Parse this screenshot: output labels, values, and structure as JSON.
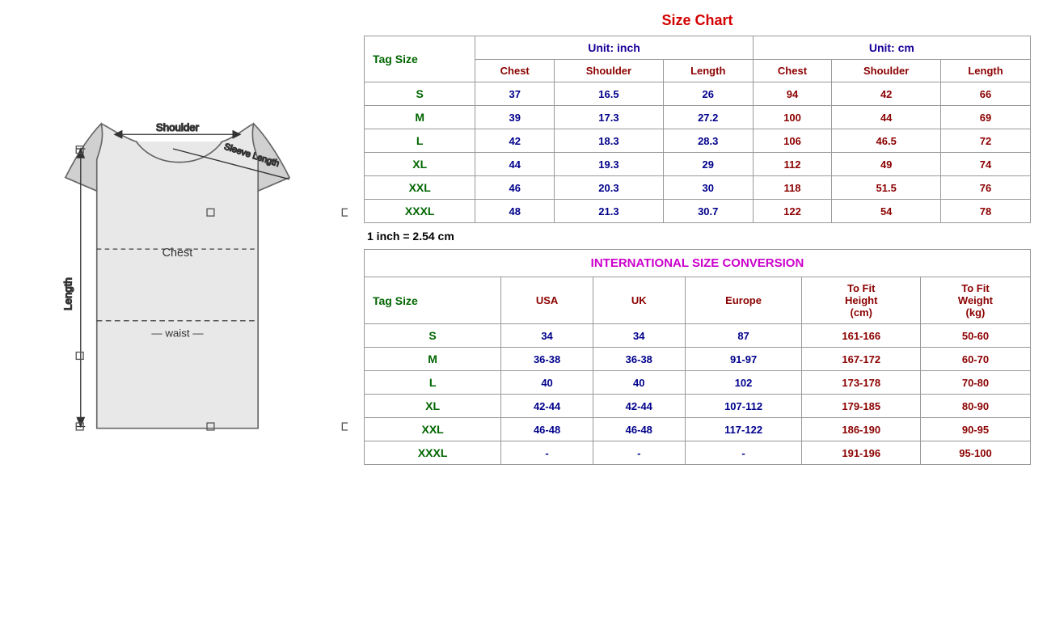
{
  "sizeChart": {
    "title": "Size Chart",
    "conversionNote": "1 inch = 2.54 cm",
    "unitInch": "Unit: inch",
    "unitCm": "Unit: cm",
    "tagSizeLabel": "Tag Size",
    "headers": {
      "chest": "Chest",
      "shoulder": "Shoulder",
      "length": "Length"
    },
    "rows": [
      {
        "tag": "S",
        "inch_chest": "37",
        "inch_shoulder": "16.5",
        "inch_length": "26",
        "cm_chest": "94",
        "cm_shoulder": "42",
        "cm_length": "66"
      },
      {
        "tag": "M",
        "inch_chest": "39",
        "inch_shoulder": "17.3",
        "inch_length": "27.2",
        "cm_chest": "100",
        "cm_shoulder": "44",
        "cm_length": "69"
      },
      {
        "tag": "L",
        "inch_chest": "42",
        "inch_shoulder": "18.3",
        "inch_length": "28.3",
        "cm_chest": "106",
        "cm_shoulder": "46.5",
        "cm_length": "72"
      },
      {
        "tag": "XL",
        "inch_chest": "44",
        "inch_shoulder": "19.3",
        "inch_length": "29",
        "cm_chest": "112",
        "cm_shoulder": "49",
        "cm_length": "74"
      },
      {
        "tag": "XXL",
        "inch_chest": "46",
        "inch_shoulder": "20.3",
        "inch_length": "30",
        "cm_chest": "118",
        "cm_shoulder": "51.5",
        "cm_length": "76"
      },
      {
        "tag": "XXXL",
        "inch_chest": "48",
        "inch_shoulder": "21.3",
        "inch_length": "30.7",
        "cm_chest": "122",
        "cm_shoulder": "54",
        "cm_length": "78"
      }
    ]
  },
  "intlConversion": {
    "title": "INTERNATIONAL SIZE CONVERSION",
    "tagSizeLabel": "Tag Size",
    "headers": {
      "usa": "USA",
      "uk": "UK",
      "europe": "Europe",
      "toFitHeight": "To Fit Height (cm)",
      "toFitWeight": "To Fit Weight (kg)",
      "toFitLabel": "To Fit"
    },
    "rows": [
      {
        "tag": "S",
        "usa": "34",
        "uk": "34",
        "europe": "87",
        "height": "161-166",
        "weight": "50-60"
      },
      {
        "tag": "M",
        "usa": "36-38",
        "uk": "36-38",
        "europe": "91-97",
        "height": "167-172",
        "weight": "60-70"
      },
      {
        "tag": "L",
        "usa": "40",
        "uk": "40",
        "europe": "102",
        "height": "173-178",
        "weight": "70-80"
      },
      {
        "tag": "XL",
        "usa": "42-44",
        "uk": "42-44",
        "europe": "107-112",
        "height": "179-185",
        "weight": "80-90"
      },
      {
        "tag": "XXL",
        "usa": "46-48",
        "uk": "46-48",
        "europe": "117-122",
        "height": "186-190",
        "weight": "90-95"
      },
      {
        "tag": "XXXL",
        "usa": "-",
        "uk": "-",
        "europe": "-",
        "height": "191-196",
        "weight": "95-100"
      }
    ]
  }
}
